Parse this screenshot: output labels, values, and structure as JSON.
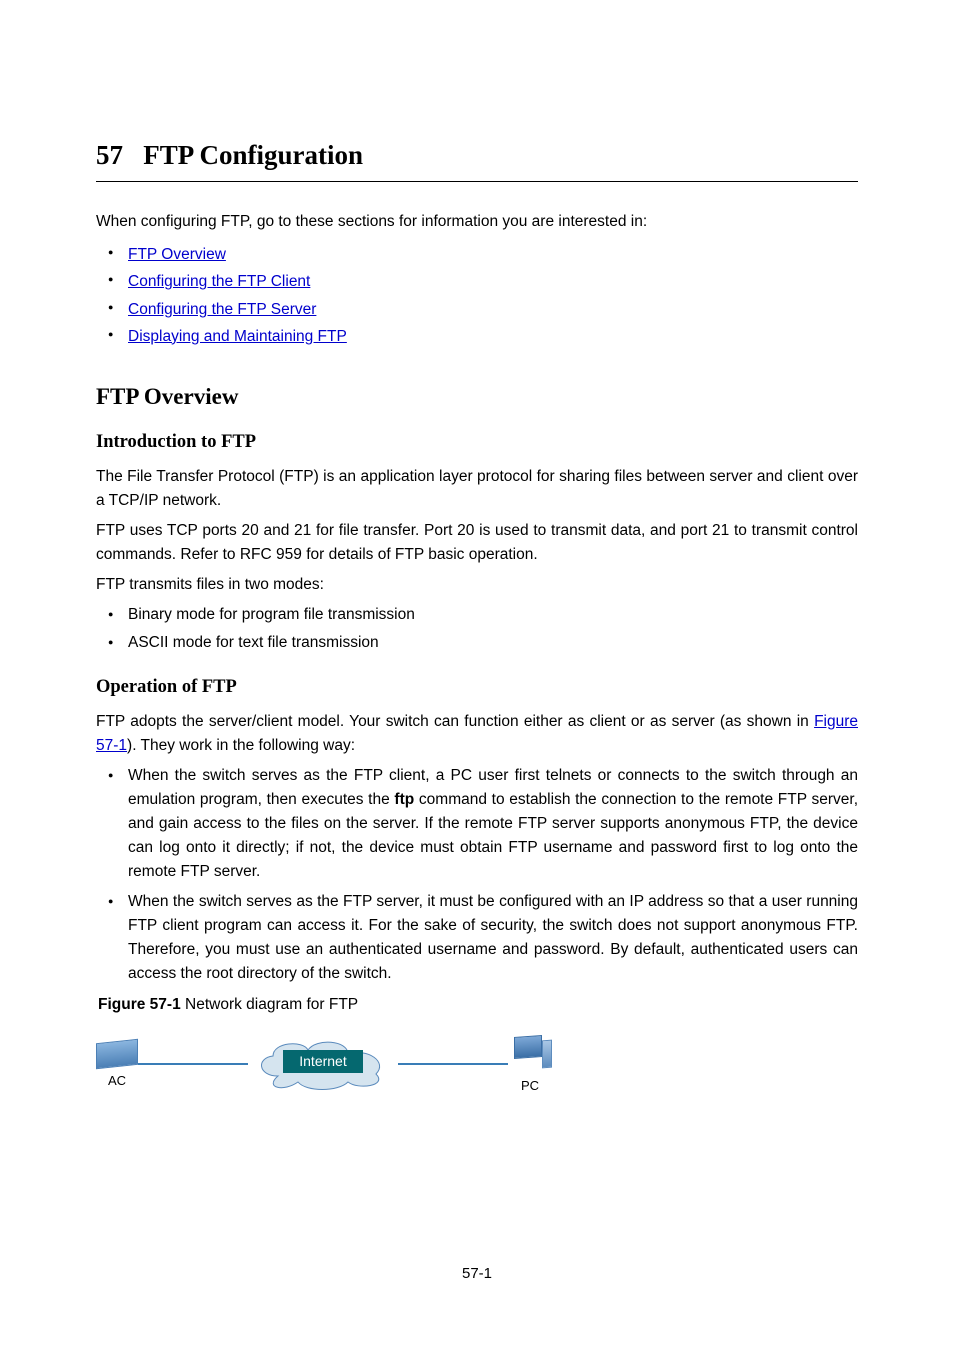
{
  "chapter": {
    "number_prefix": "57",
    "title": "FTP Configuration"
  },
  "intro": "When configuring FTP, go to these sections for information you are interested in:",
  "toc_links": [
    "FTP Overview",
    "Configuring the FTP Client",
    "Configuring the FTP Server",
    "Displaying and Maintaining FTP"
  ],
  "section1": {
    "heading": "FTP Overview",
    "sub1": {
      "heading": "Introduction to FTP",
      "p1": "The File Transfer Protocol (FTP) is an application layer protocol for sharing files between server and client over a TCP/IP network.",
      "p2": "FTP uses TCP ports 20 and 21 for file transfer. Port 20 is used to transmit data, and port 21 to transmit control commands. Refer to RFC 959 for details of FTP basic operation.",
      "p3": "FTP transmits files in two modes:",
      "bullets": [
        "Binary mode for program file transmission",
        "ASCII mode for text file transmission"
      ]
    },
    "sub2": {
      "heading": "Operation of FTP",
      "p1_pre": "FTP adopts the server/client model. Your switch can function either as client or as server (as shown in ",
      "p1_link": "Figure 57-1",
      "p1_post": "). They work in the following way:",
      "bullets": [
        {
          "pre": "When the switch serves as the FTP client, a PC user first telnets or connects to the switch through an emulation program, then executes the ",
          "cmd": "ftp",
          "post": " command to establish the connection to the remote FTP server, and gain access to the files on the server. If the remote FTP server supports anonymous FTP, the device can log onto it directly; if not, the device must obtain FTP username and password first to log onto the remote FTP server."
        },
        {
          "text": "When the switch serves as the FTP server, it must be configured with an IP address so that a user running FTP client program can access it. For the sake of security, the switch does not support anonymous FTP. Therefore, you must use an authenticated username and password. By default, authenticated users can access the root directory of the switch."
        }
      ],
      "figure": {
        "label": "Figure 57-1",
        "caption": "Network diagram for FTP",
        "left_label": "AC",
        "cloud_label": "Internet",
        "right_label": "PC"
      }
    }
  },
  "page_number": "57-1"
}
